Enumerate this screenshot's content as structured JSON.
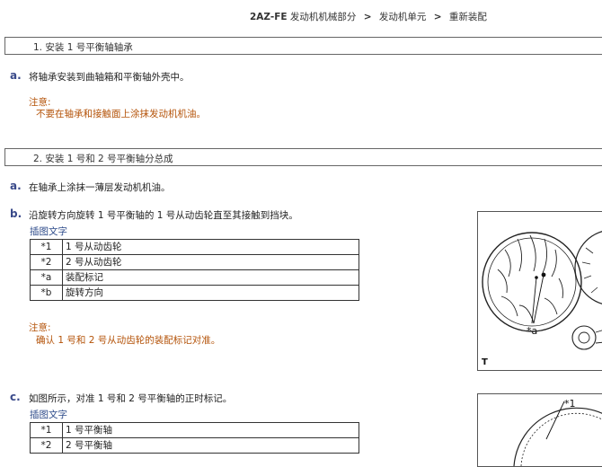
{
  "breadcrumb": {
    "model": "2AZ-FE",
    "items": [
      "发动机机械部分",
      "发动机单元",
      "重新装配"
    ],
    "separator": ">"
  },
  "sections": [
    {
      "title": "1. 安装 1 号平衡轴轴承",
      "steps": [
        {
          "letter": "a.",
          "text": "将轴承安装到曲轴箱和平衡轴外壳中。",
          "note_title": "注意:",
          "note_body": "不要在轴承和接触面上涂抹发动机机油。"
        }
      ]
    },
    {
      "title": "2. 安装 1 号和 2 号平衡轴分总成",
      "steps": [
        {
          "letter": "a.",
          "text": "在轴承上涂抹一薄层发动机机油。"
        },
        {
          "letter": "b.",
          "text": "沿旋转方向旋转 1 号平衡轴的 1 号从动齿轮直至其接触到挡块。",
          "caption": "插图文字",
          "legend": [
            {
              "key": "*1",
              "value": "1 号从动齿轮"
            },
            {
              "key": "*2",
              "value": "2 号从动齿轮"
            },
            {
              "key": "*a",
              "value": "装配标记"
            },
            {
              "key": "*b",
              "value": "旋转方向"
            }
          ],
          "note_title": "注意:",
          "note_body": "确认 1 号和 2 号从动齿轮的装配标记对准。",
          "figure_labels": [
            "*a",
            "T"
          ]
        },
        {
          "letter": "c.",
          "text": "如图所示，对准 1 号和 2 号平衡轴的正时标记。",
          "caption": "插图文字",
          "legend": [
            {
              "key": "*1",
              "value": "1 号平衡轴"
            },
            {
              "key": "*2",
              "value": "2 号平衡轴"
            }
          ],
          "figure_labels": [
            "*1"
          ]
        }
      ]
    }
  ],
  "colors": {
    "step_letter": "#3a4a8a",
    "note": "#b45309",
    "caption": "#2c4a8a",
    "border": "#333333"
  }
}
